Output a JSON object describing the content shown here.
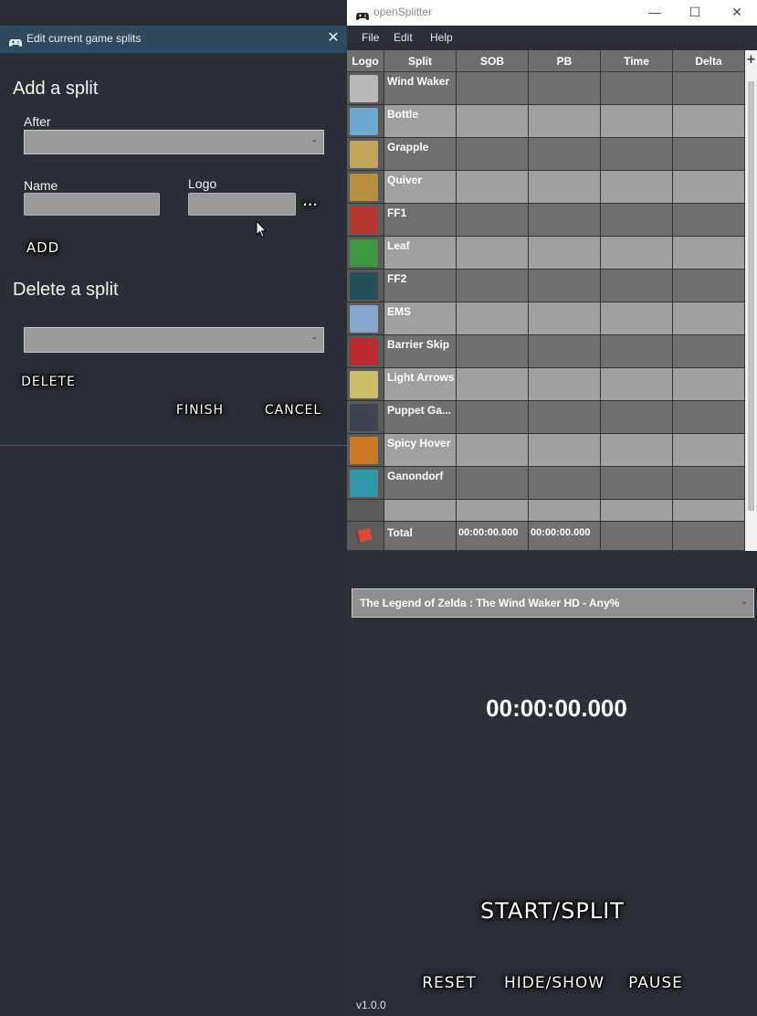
{
  "dialog": {
    "title": "Edit current game splits",
    "close_glyph": "✕",
    "add_heading": "Add a split",
    "after_label": "After",
    "after_value": "",
    "name_label": "Name",
    "name_value": "",
    "logo_label": "Logo",
    "logo_value": "",
    "browse_label": "...",
    "add_button": "ADD",
    "delete_heading": "Delete a split",
    "delete_value": "",
    "delete_button": "DELETE",
    "finish_button": "FINISH",
    "cancel_button": "CANCEL"
  },
  "main": {
    "app_title": "openSplitter",
    "window_controls": {
      "minimize": "—",
      "maximize": "☐",
      "close": "✕"
    },
    "menu": [
      "File",
      "Edit",
      "Help"
    ],
    "table": {
      "columns": [
        "Logo",
        "Split",
        "SOB",
        "PB",
        "Time",
        "Delta"
      ],
      "add_column_glyph": "+",
      "rows": [
        {
          "name": "Wind Waker",
          "icon": "wind-waker-icon",
          "color": "#c9c9c9"
        },
        {
          "name": "Bottle",
          "icon": "bottle-icon",
          "color": "#6fb7e8"
        },
        {
          "name": "Grapple",
          "icon": "grapple-icon",
          "color": "#d6b35a"
        },
        {
          "name": "Quiver",
          "icon": "quiver-icon",
          "color": "#c89a3a"
        },
        {
          "name": "FF1",
          "icon": "ff1-icon",
          "color": "#c8302a"
        },
        {
          "name": "Leaf",
          "icon": "leaf-icon",
          "color": "#3aa23a"
        },
        {
          "name": "FF2",
          "icon": "ff2-icon",
          "color": "#1c4f5a"
        },
        {
          "name": "EMS",
          "icon": "master-sword-icon",
          "color": "#8fb4e0"
        },
        {
          "name": "Barrier Skip",
          "icon": "barrier-icon",
          "color": "#d0202a"
        },
        {
          "name": "Light Arrows",
          "icon": "light-arrow-icon",
          "color": "#e2d06a"
        },
        {
          "name": "Puppet Ga...",
          "icon": "puppet-ganon-icon",
          "color": "#3a4050"
        },
        {
          "name": "Spicy Hover",
          "icon": "spicy-hover-icon",
          "color": "#e07a1a"
        },
        {
          "name": "Ganondorf",
          "icon": "ganondorf-icon",
          "color": "#2aa3b8"
        }
      ],
      "total": {
        "label": "Total",
        "sob": "00:00:00.000",
        "pb": "00:00:00.000",
        "icon": "flag-icon"
      }
    },
    "game_category": "The Legend of Zelda : The Wind Waker HD - Any%",
    "timer": "00:00:00.000",
    "buttons": {
      "start_split": "START/SPLIT",
      "reset": "RESET",
      "hide_show": "HIDE/SHOW",
      "pause": "PAUSE"
    },
    "version": "v1.0.0"
  }
}
